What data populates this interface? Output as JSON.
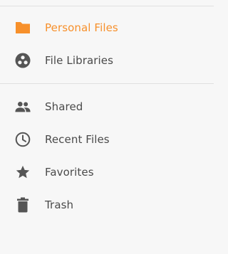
{
  "nav": {
    "primary": [
      {
        "label": "Personal Files",
        "icon": "folder-icon",
        "active": true
      },
      {
        "label": "File Libraries",
        "icon": "libraries-icon",
        "active": false
      }
    ],
    "secondary": [
      {
        "label": "Shared",
        "icon": "people-icon",
        "active": false
      },
      {
        "label": "Recent Files",
        "icon": "clock-icon",
        "active": false
      },
      {
        "label": "Favorites",
        "icon": "star-icon",
        "active": false
      },
      {
        "label": "Trash",
        "icon": "trash-icon",
        "active": false
      }
    ]
  },
  "colors": {
    "accent": "#f7902b",
    "icon": "#555555",
    "text": "#4a4a4a",
    "background": "#f7f7f7",
    "divider": "#e0e0e0"
  }
}
